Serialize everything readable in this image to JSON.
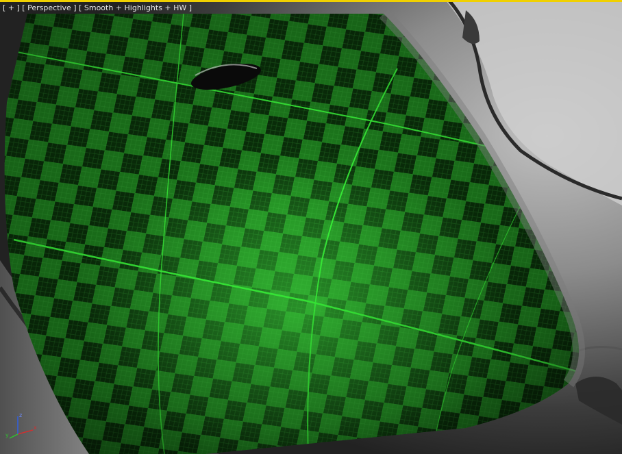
{
  "viewport": {
    "label_plus": "[ + ]",
    "label_view": "[ Perspective ]",
    "label_shading": "[ Smooth + Highlights + HW ]"
  },
  "colors": {
    "active_border": "#f0d000",
    "checker_light": "#1f8a1f",
    "checker_dark": "#062606",
    "seam": "#39ff39",
    "label_text": "#e6e6e6",
    "axis_x": "#d03030",
    "axis_y": "#30c030",
    "axis_z": "#3060e0"
  },
  "gizmo": {
    "x_label": "x",
    "y_label": "y",
    "z_label": "z"
  }
}
